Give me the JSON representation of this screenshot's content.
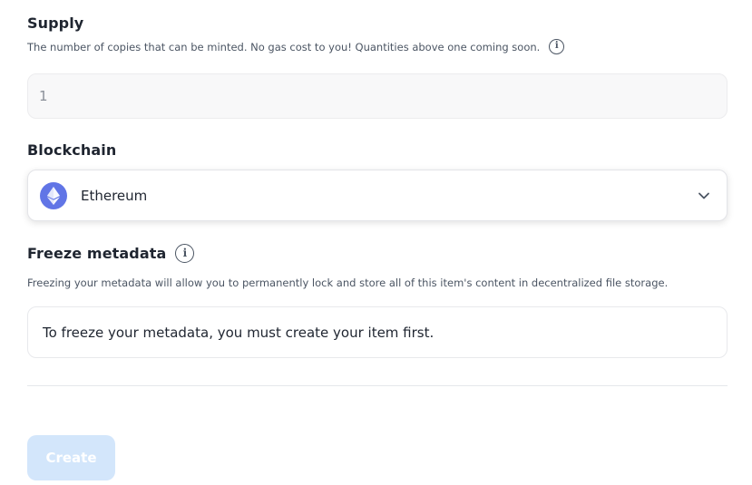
{
  "supply": {
    "title": "Supply",
    "helper": "The number of copies that can be minted. No gas cost to you! Quantities above one coming soon.",
    "info_icon": "info-icon",
    "value": "1"
  },
  "blockchain": {
    "title": "Blockchain",
    "selected": "Ethereum",
    "selected_icon": "ethereum-icon",
    "dropdown_icon": "chevron-down-icon"
  },
  "freeze": {
    "title": "Freeze metadata",
    "info_icon": "info-icon",
    "helper": "Freezing your metadata will allow you to permanently lock and store all of this item's content in decentralized file storage.",
    "notice": "To freeze your metadata, you must create your item first."
  },
  "actions": {
    "create_label": "Create",
    "create_color": "#d3e6fb"
  },
  "colors": {
    "ethereum": "#6175e6",
    "text": "#1f2530"
  }
}
